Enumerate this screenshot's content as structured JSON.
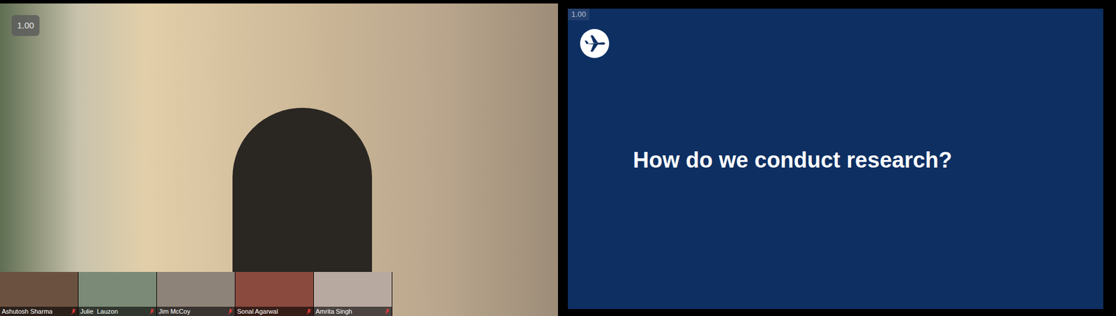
{
  "main_video": {
    "speed_badge": "1.00"
  },
  "participants": [
    {
      "name": "Ashutosh Sharma",
      "muted": true
    },
    {
      "name": "Julie  Lauzon",
      "muted": true
    },
    {
      "name": "Jim McCoy",
      "muted": true
    },
    {
      "name": "Sonal Agarwal",
      "muted": true
    },
    {
      "name": "Amrita Singh",
      "muted": true
    }
  ],
  "slide": {
    "speed_badge": "1.00",
    "title": "How do we conduct research?"
  }
}
